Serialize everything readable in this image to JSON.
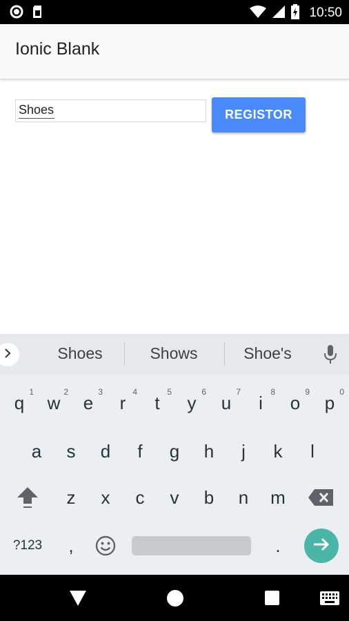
{
  "status_bar": {
    "time": "10:50",
    "icons": [
      "record-icon",
      "sim-card-icon",
      "wifi-icon",
      "signal-icon",
      "battery-charging-icon"
    ]
  },
  "header": {
    "title": "Ionic Blank"
  },
  "form": {
    "input_value": "Shoes",
    "register_label": "REGISTOR"
  },
  "keyboard": {
    "suggestions": [
      "Shoes",
      "Shows",
      "Shoe's"
    ],
    "row1": [
      {
        "key": "q",
        "hint": "1"
      },
      {
        "key": "w",
        "hint": "2"
      },
      {
        "key": "e",
        "hint": "3"
      },
      {
        "key": "r",
        "hint": "4"
      },
      {
        "key": "t",
        "hint": "5"
      },
      {
        "key": "y",
        "hint": "6"
      },
      {
        "key": "u",
        "hint": "7"
      },
      {
        "key": "i",
        "hint": "8"
      },
      {
        "key": "o",
        "hint": "9"
      },
      {
        "key": "p",
        "hint": "0"
      }
    ],
    "row2": [
      "a",
      "s",
      "d",
      "f",
      "g",
      "h",
      "j",
      "k",
      "l"
    ],
    "row3": [
      "z",
      "x",
      "c",
      "v",
      "b",
      "n",
      "m"
    ],
    "symbols_label": "?123",
    "comma": ",",
    "period": ".",
    "accent": "#4ab6a8"
  },
  "colors": {
    "button": "#4a8bfc",
    "header_bg": "#f8f8f8",
    "keyboard_bg": "#eceff1"
  }
}
